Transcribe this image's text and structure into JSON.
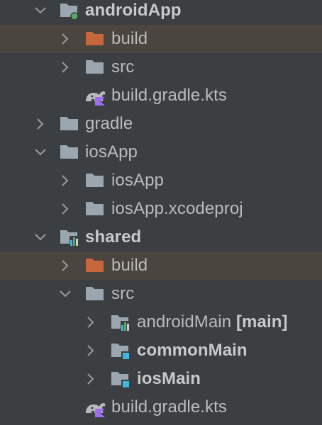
{
  "tree": {
    "android_app": {
      "label": "androidApp"
    },
    "android_build": {
      "label": "build"
    },
    "android_src": {
      "label": "src"
    },
    "android_gradle_file": {
      "label": "build.gradle.kts"
    },
    "gradle": {
      "label": "gradle"
    },
    "ios_app": {
      "label": "iosApp"
    },
    "ios_app_inner": {
      "label": "iosApp"
    },
    "ios_xcodeproj": {
      "label": "iosApp.xcodeproj"
    },
    "shared": {
      "label": "shared"
    },
    "shared_build": {
      "label": "build"
    },
    "shared_src": {
      "label": "src"
    },
    "android_main": {
      "label": "androidMain",
      "suffix": "[main]"
    },
    "common_main": {
      "label": "commonMain"
    },
    "ios_main": {
      "label": "iosMain"
    },
    "shared_gradle_file": {
      "label": "build.gradle.kts"
    }
  },
  "colors": {
    "background": "#3c3f41",
    "highlight_row": "#4a453f",
    "folder_gray": "#9aa7b0",
    "folder_excluded": "#c7653c",
    "module_dot": "#59a869",
    "source_marker": "#40b6e0",
    "gradle_elephant": "#b9b9b9",
    "kotlin_mark": "#9f6cf5"
  },
  "icons": {
    "android_app": "module-folder-icon",
    "excluded": "excluded-folder-icon",
    "folder": "folder-icon",
    "gradle_file": "gradle-kotlin-file-icon",
    "shared": "library-module-folder-icon",
    "source_set": "source-root-folder-icon"
  }
}
